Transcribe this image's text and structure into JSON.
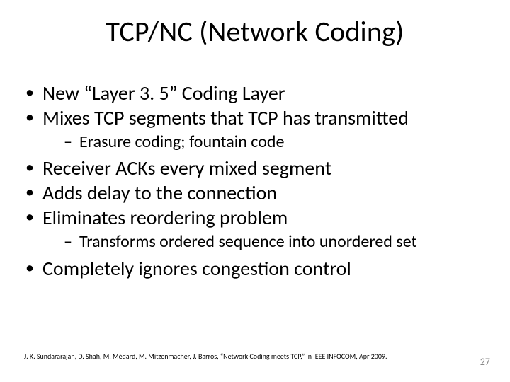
{
  "title": "TCP/NC (Network Coding)",
  "bullets": {
    "b1": "New “Layer 3. 5” Coding Layer",
    "b2": "Mixes TCP segments that TCP has transmitted",
    "b2s1": "Erasure coding; fountain code",
    "b3": "Receiver ACKs every mixed segment",
    "b4": "Adds delay to the connection",
    "b5": "Eliminates reordering problem",
    "b5s1": "Transforms ordered sequence into unordered set",
    "b6": "Completely ignores congestion control"
  },
  "citation": "J. K. Sundararajan, D. Shah, M. Médard, M. Mitzenmacher, J. Barros, “Network Coding meets TCP,” in IEEE INFOCOM, Apr 2009.",
  "page_number": "27"
}
